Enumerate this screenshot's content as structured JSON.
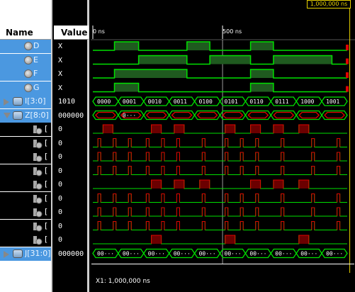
{
  "header": {
    "name_col": "Name",
    "value_col": "Value"
  },
  "timeline": {
    "t0": "0 ns",
    "t500": "500 ns",
    "cursor_readout": "1,000,000 ns"
  },
  "signals": [
    {
      "name": "D",
      "value": "X",
      "kind": "sig",
      "selected": true,
      "high": [
        [
          0.085,
          0.18
        ],
        [
          0.37,
          0.46
        ],
        [
          0.62,
          0.71
        ]
      ]
    },
    {
      "name": "E",
      "value": "X",
      "kind": "sig",
      "selected": true,
      "high": [
        [
          0.18,
          0.37
        ],
        [
          0.46,
          0.62
        ],
        [
          0.71,
          0.94
        ]
      ]
    },
    {
      "name": "F",
      "value": "X",
      "kind": "sig",
      "selected": true,
      "high": [
        [
          0.085,
          0.37
        ],
        [
          0.62,
          0.71
        ]
      ]
    },
    {
      "name": "G",
      "value": "X",
      "kind": "sig",
      "selected": true,
      "high": [
        [
          0.085,
          0.18
        ],
        [
          0.62,
          0.71
        ]
      ]
    },
    {
      "name": "I[3:0]",
      "value": "1010",
      "kind": "bus",
      "selected": true,
      "expand": "right",
      "labels": [
        "0000",
        "0001",
        "0010",
        "0011",
        "0100",
        "0101",
        "0110",
        "0111",
        "1000",
        "1001"
      ]
    },
    {
      "name": "Z[8:0]",
      "value": "000000",
      "kind": "bus",
      "selected": true,
      "expand": "down",
      "labels": [
        "",
        "0···",
        "",
        "",
        "",
        "",
        "",
        "",
        "",
        ""
      ]
    },
    {
      "name": "[",
      "value": "0",
      "kind": "bit",
      "pulses": [
        0.04,
        0.23,
        0.32,
        0.52,
        0.62,
        0.71,
        0.81
      ]
    },
    {
      "name": "[",
      "value": "0",
      "kind": "bit",
      "pulses": [
        0.02,
        0.08,
        0.14,
        0.21,
        0.27,
        0.33,
        0.43,
        0.52,
        0.58,
        0.64,
        0.74,
        0.86,
        0.96
      ]
    },
    {
      "name": "[",
      "value": "0",
      "kind": "bit",
      "pulses": [
        0.02,
        0.08,
        0.14,
        0.21,
        0.27,
        0.33,
        0.43,
        0.52,
        0.58,
        0.64,
        0.74,
        0.86,
        0.96
      ]
    },
    {
      "name": "[",
      "value": "0",
      "kind": "bit",
      "pulses": [
        0.02,
        0.08,
        0.14,
        0.21,
        0.27,
        0.33,
        0.43,
        0.52,
        0.58,
        0.64,
        0.74,
        0.86,
        0.96
      ]
    },
    {
      "name": "[",
      "value": "0",
      "kind": "bit",
      "pulses": [
        0.23,
        0.32,
        0.42,
        0.62,
        0.71,
        0.81
      ]
    },
    {
      "name": "[",
      "value": "0",
      "kind": "bit",
      "pulses": [
        0.02,
        0.08,
        0.14,
        0.21,
        0.27,
        0.33,
        0.43,
        0.52,
        0.58,
        0.64,
        0.74,
        0.86,
        0.96
      ]
    },
    {
      "name": "[",
      "value": "0",
      "kind": "bit",
      "pulses": [
        0.02,
        0.08,
        0.14,
        0.21,
        0.27,
        0.33,
        0.43,
        0.52,
        0.58,
        0.64,
        0.74,
        0.86,
        0.96
      ]
    },
    {
      "name": "[",
      "value": "0",
      "kind": "bit",
      "pulses": [
        0.02,
        0.08,
        0.14,
        0.21,
        0.27,
        0.33,
        0.43,
        0.52,
        0.58,
        0.64,
        0.74,
        0.86,
        0.96
      ]
    },
    {
      "name": "[",
      "value": "0",
      "kind": "bit",
      "pulses": [
        0.23,
        0.52,
        0.81
      ]
    },
    {
      "name": "J[31:0]",
      "value": "000000",
      "kind": "bus",
      "selected": true,
      "expand": "right",
      "labels": [
        "00···",
        "00···",
        "00···",
        "00···",
        "00···",
        "00···",
        "00···",
        "00···",
        "00···",
        "00···"
      ]
    }
  ],
  "status_bar": {
    "cursor_text": "X1: 1,000,000 ns"
  },
  "colors": {
    "wave": "#00e000",
    "low_fill": "#1f5a1f",
    "x_value": "#e00000",
    "cursor": "#e8d300",
    "selection": "#4b98e0"
  }
}
